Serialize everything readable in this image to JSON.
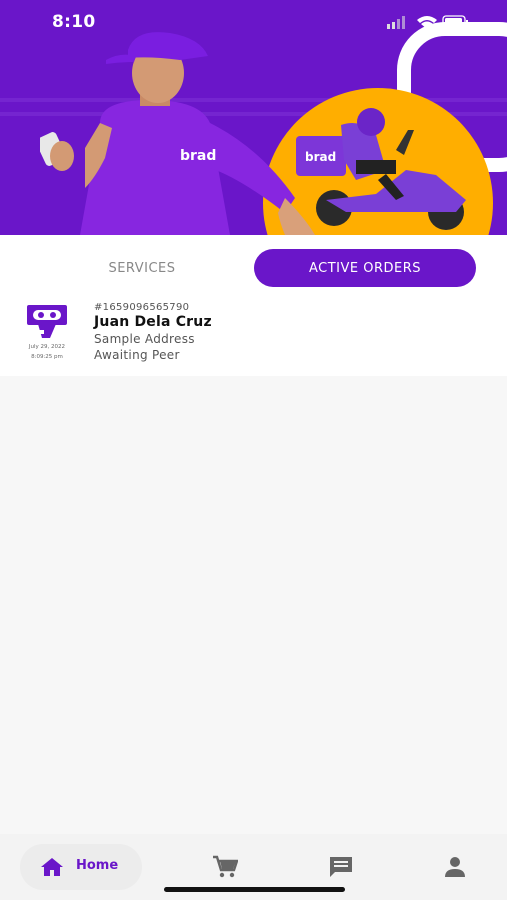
{
  "status_bar": {
    "time": "8:10"
  },
  "hero": {
    "brand_text": "brad"
  },
  "tabs": [
    {
      "label": "SERVICES",
      "active": false
    },
    {
      "label": "ACTIVE ORDERS",
      "active": true
    }
  ],
  "order": {
    "icon": "delivery-service-icon",
    "date": "July 29, 2022",
    "time": "8:09:25 pm",
    "order_number": "#1659096565790",
    "customer_name": "Juan Dela Cruz",
    "address": "Sample Address",
    "status": "Awaiting Peer"
  },
  "bottom_nav": [
    {
      "label": "Home",
      "icon": "home-icon",
      "active": true
    },
    {
      "label": "",
      "icon": "cart-icon",
      "active": false
    },
    {
      "label": "",
      "icon": "chat-icon",
      "active": false
    },
    {
      "label": "",
      "icon": "profile-icon",
      "active": false
    }
  ],
  "colors": {
    "brand": "#6a16c9",
    "accent": "#ffae00"
  }
}
